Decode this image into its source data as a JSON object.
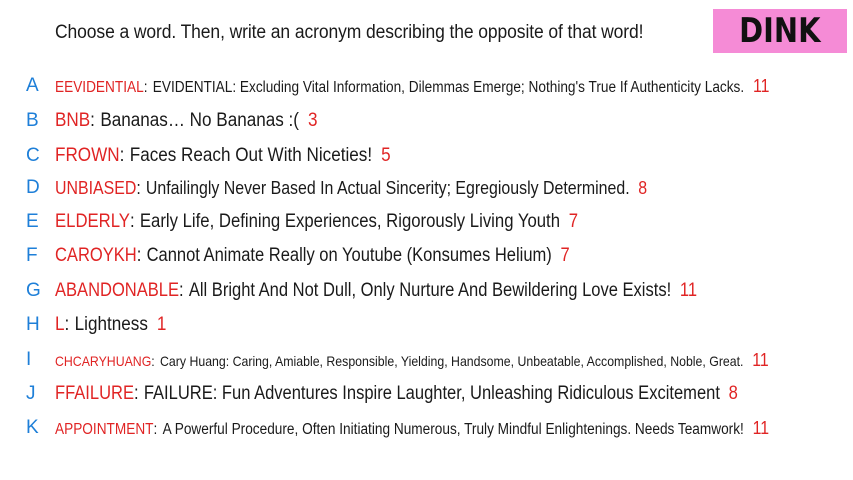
{
  "prompt": "Choose a word. Then, write an acronym describing the opposite of that word!",
  "badge": {
    "text": "DINK",
    "color": "#f58bd6"
  },
  "colors": {
    "letter": "#1e7fd8",
    "word": "#e02424",
    "number": "#e02424",
    "text": "#1a1a1a"
  },
  "entries": [
    {
      "letter": "A",
      "word": "EEVIDENTIAL",
      "description": "EVIDENTIAL: Excluding Vital Information, Dilemmas Emerge; Nothing's True If Authenticity Lacks.",
      "votes": "11"
    },
    {
      "letter": "B",
      "word": "BNB",
      "description": "Bananas… No Bananas :(",
      "votes": "3"
    },
    {
      "letter": "C",
      "word": "FROWN",
      "description": "Faces Reach Out With Niceties!",
      "votes": "5"
    },
    {
      "letter": "D",
      "word": "UNBIASED",
      "description": "Unfailingly Never Based In Actual Sincerity; Egregiously Determined.",
      "votes": "8"
    },
    {
      "letter": "E",
      "word": "ELDERLY",
      "description": "Early Life, Defining Experiences, Rigorously Living Youth",
      "votes": "7"
    },
    {
      "letter": "F",
      "word": "CAROYKH",
      "description": "Cannot Animate Really on Youtube (Konsumes Helium)",
      "votes": "7"
    },
    {
      "letter": "G",
      "word": "ABANDONABLE",
      "description": "All Bright And Not Dull, Only Nurture And Bewildering Love Exists!",
      "votes": "11"
    },
    {
      "letter": "H",
      "word": "L",
      "description": "Lightness",
      "votes": "1"
    },
    {
      "letter": "I",
      "word": "CHCARYHUANG",
      "description": "Cary Huang: Caring, Amiable, Responsible, Yielding, Handsome, Unbeatable, Accomplished, Noble, Great.",
      "votes": "11"
    },
    {
      "letter": "J",
      "word": "FFAILURE",
      "description": "FAILURE: Fun Adventures Inspire Laughter, Unleashing Ridiculous Excitement",
      "votes": "8"
    },
    {
      "letter": "K",
      "word": "APPOINTMENT",
      "description": "A Powerful Procedure, Often Initiating Numerous, Truly Mindful Enlightenings. Needs Teamwork!",
      "votes": "11"
    }
  ]
}
